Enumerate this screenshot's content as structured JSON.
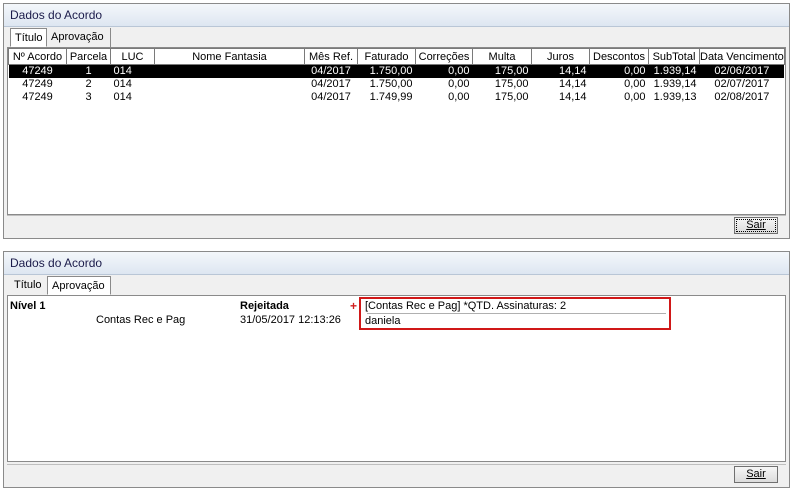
{
  "panel1": {
    "title": "Dados do Acordo",
    "tabs": [
      "Título",
      "Aprovação"
    ],
    "columns": [
      "Nº Acordo",
      "Parcela",
      "LUC",
      "Nome Fantasia",
      "Mês Ref.",
      "Faturado",
      "Correções",
      "Multa",
      "Juros",
      "Descontos",
      "SubTotal",
      "Data Vencimento"
    ],
    "rows": [
      [
        "47249",
        "1",
        "014",
        "",
        "04/2017",
        "1.750,00",
        "0,00",
        "175,00",
        "14,14",
        "0,00",
        "1.939,14",
        "02/06/2017"
      ],
      [
        "47249",
        "2",
        "014",
        "",
        "04/2017",
        "1.750,00",
        "0,00",
        "175,00",
        "14,14",
        "0,00",
        "1.939,14",
        "02/07/2017"
      ],
      [
        "47249",
        "3",
        "014",
        "",
        "04/2017",
        "1.749,99",
        "0,00",
        "175,00",
        "14,14",
        "0,00",
        "1.939,13",
        "02/08/2017"
      ]
    ],
    "selected_row": 0,
    "button": "Sair"
  },
  "panel2": {
    "title": "Dados do Acordo",
    "tabs": [
      "Título",
      "Aprovação"
    ],
    "level_label": "Nível 1",
    "status": "Rejeitada",
    "group": "Contas Rec e Pag",
    "date": "31/05/2017 12:13:26",
    "marker": "+",
    "signature_header": "[Contas Rec e Pag]      *QTD. Assinaturas: 2",
    "signer": "daniela",
    "button": "Sair"
  },
  "colors": {
    "highlight": "#d01818",
    "selection": "#000000",
    "titlebar_text": "#1b1b4a"
  }
}
